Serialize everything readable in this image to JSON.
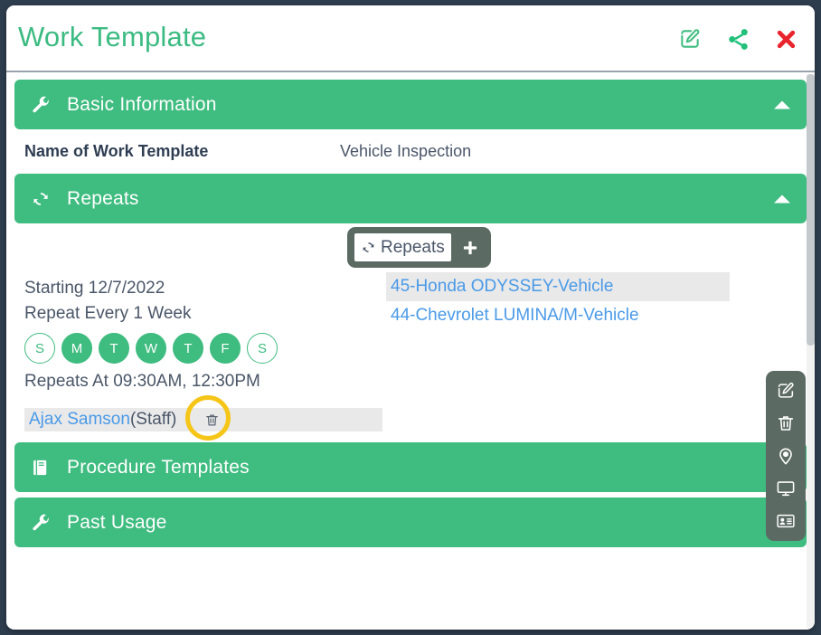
{
  "header": {
    "title": "Work Template",
    "actions": [
      {
        "name": "edit-icon",
        "label": "Edit"
      },
      {
        "name": "share-icon",
        "label": "Share"
      },
      {
        "name": "close-icon",
        "label": "Close"
      }
    ]
  },
  "sections": {
    "basic_information": {
      "label": "Basic Information",
      "icon": "wrench-icon",
      "expanded": true,
      "field_label": "Name of Work Template",
      "field_value": "Vehicle Inspection"
    },
    "repeats": {
      "label": "Repeats",
      "icon": "sync-icon",
      "expanded": true,
      "subtab_label": "Repeats",
      "add_label": "+",
      "starting_text": "Starting 12/7/2022",
      "repeat_every_text": "Repeat Every 1 Week",
      "repeats_at_text": "Repeats At 09:30AM, 12:30PM",
      "days": [
        {
          "letter": "S",
          "selected": false
        },
        {
          "letter": "M",
          "selected": true
        },
        {
          "letter": "T",
          "selected": true
        },
        {
          "letter": "W",
          "selected": true
        },
        {
          "letter": "T",
          "selected": true
        },
        {
          "letter": "F",
          "selected": true
        },
        {
          "letter": "S",
          "selected": false
        }
      ],
      "assets": [
        {
          "label": "45-Honda ODYSSEY-Vehicle",
          "highlighted": true
        },
        {
          "label": "44-Chevrolet LUMINA/M-Vehicle",
          "highlighted": false
        }
      ],
      "staff": {
        "name": "Ajax Samson",
        "suffix": "(Staff)",
        "delete_icon": "trash-icon"
      }
    },
    "procedure_templates": {
      "label": "Procedure Templates",
      "icon": "book-icon",
      "expanded": false
    },
    "past_usage": {
      "label": "Past Usage",
      "icon": "wrench-icon",
      "expanded": false
    }
  },
  "side_toolbar": {
    "items": [
      {
        "name": "edit-icon",
        "label": "Edit"
      },
      {
        "name": "trash-icon",
        "label": "Delete"
      },
      {
        "name": "location-icon",
        "label": "Location"
      },
      {
        "name": "monitor-icon",
        "label": "Display"
      },
      {
        "name": "contact-card-icon",
        "label": "Contact"
      }
    ]
  },
  "colors": {
    "brand_green": "#3fbc80",
    "link_blue": "#4a9ae8",
    "close_red": "#e8242c",
    "toolbar_gray": "#5b6a63",
    "highlight_yellow": "#f5c518",
    "text_dark": "#2f3e53"
  }
}
